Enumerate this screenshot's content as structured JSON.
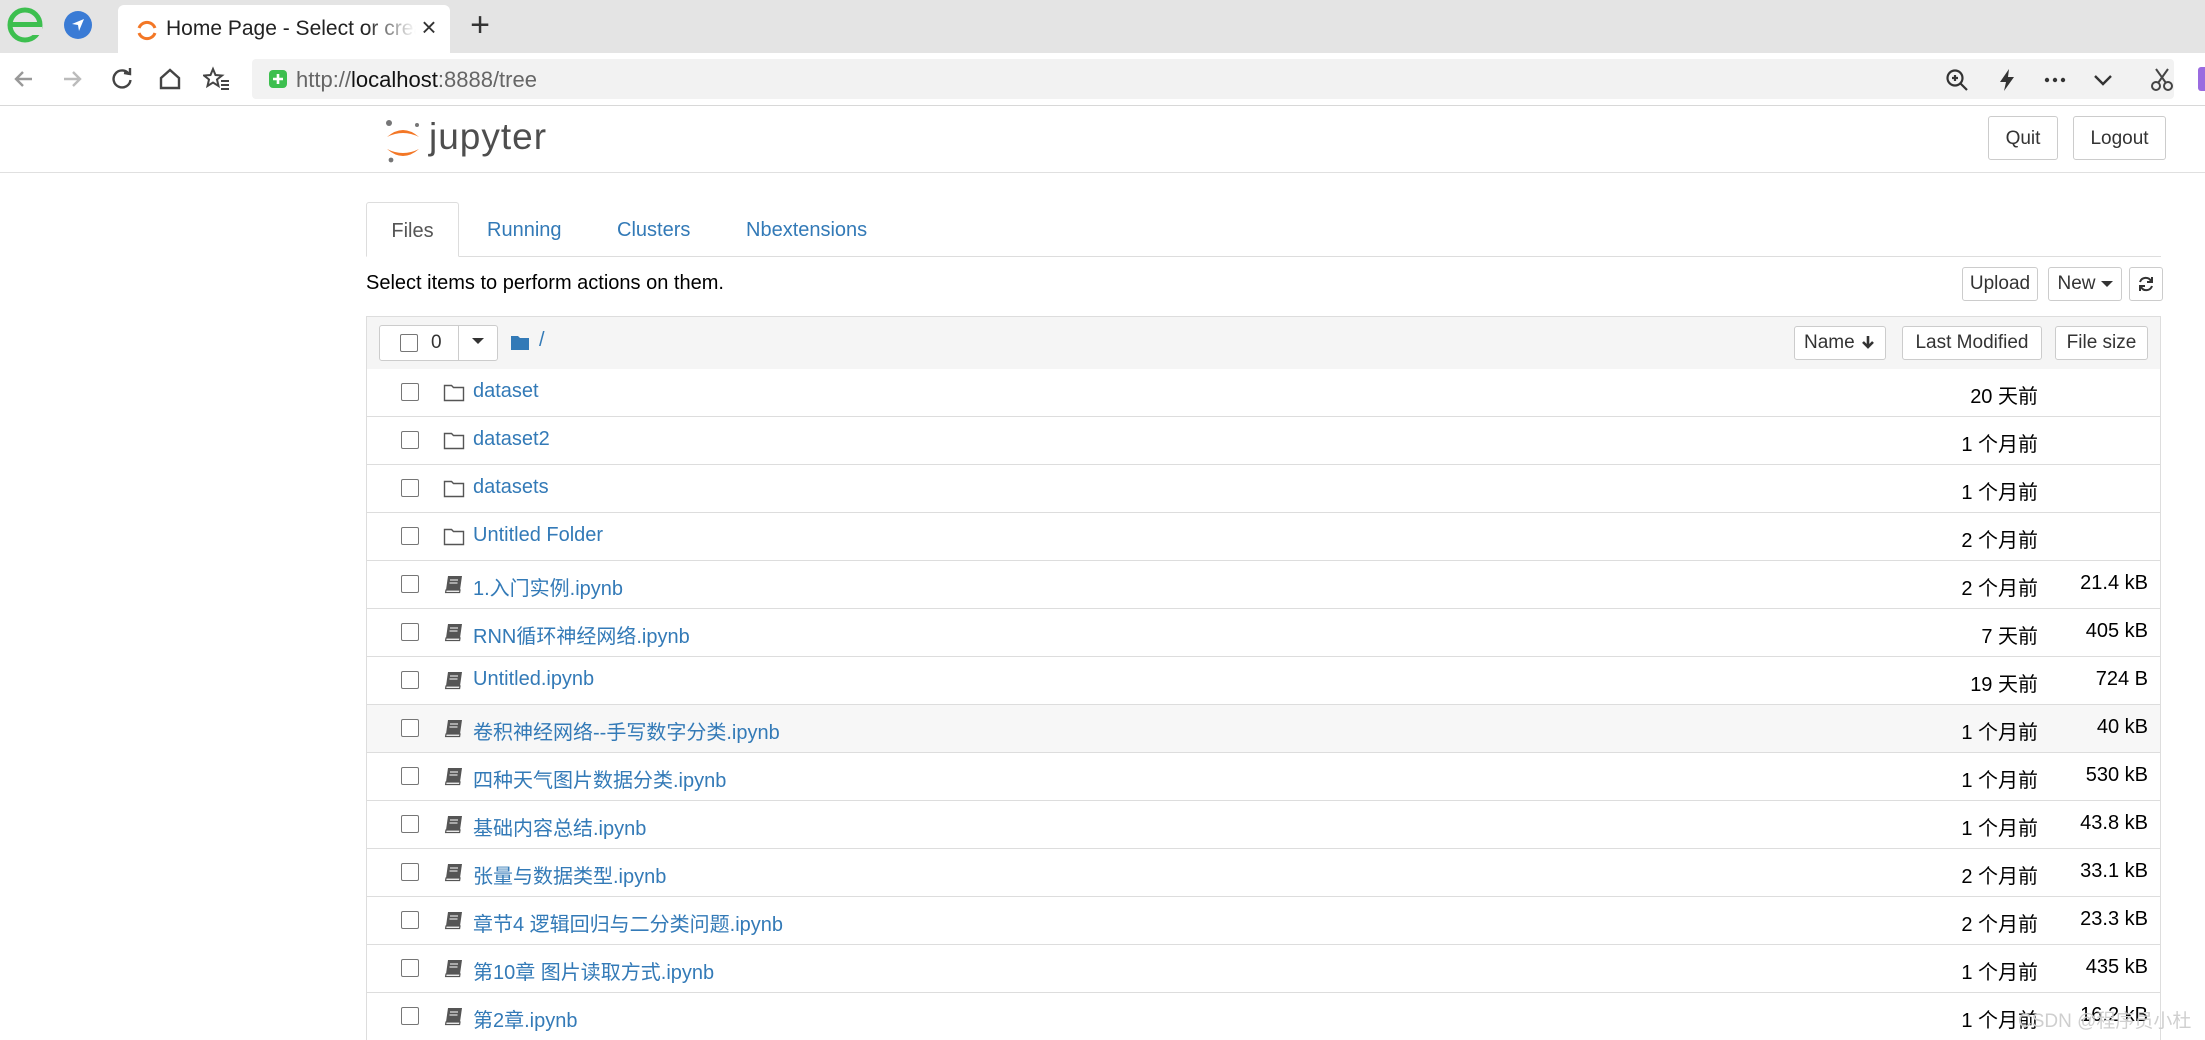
{
  "browser": {
    "tab_title": "Home Page - Select or create a notebook",
    "url_prefix": "http://",
    "url_host": "localhost",
    "url_rest": ":8888/tree"
  },
  "header": {
    "logo_text": "jupyter",
    "quit_label": "Quit",
    "logout_label": "Logout"
  },
  "tabs": [
    {
      "label": "Files"
    },
    {
      "label": "Running"
    },
    {
      "label": "Clusters"
    },
    {
      "label": "Nbextensions"
    }
  ],
  "toolbar": {
    "instructions": "Select items to perform actions on them.",
    "upload_label": "Upload",
    "new_label": "New"
  },
  "list_header": {
    "selected_count": "0",
    "breadcrumb": "/",
    "name_label": "Name",
    "last_modified_label": "Last Modified",
    "file_size_label": "File size"
  },
  "items": [
    {
      "type": "folder",
      "name": "dataset",
      "modified": "20 天前",
      "size": ""
    },
    {
      "type": "folder",
      "name": "dataset2",
      "modified": "1 个月前",
      "size": ""
    },
    {
      "type": "folder",
      "name": "datasets",
      "modified": "1 个月前",
      "size": ""
    },
    {
      "type": "folder",
      "name": "Untitled Folder",
      "modified": "2 个月前",
      "size": ""
    },
    {
      "type": "notebook",
      "name": "1.入门实例.ipynb",
      "modified": "2 个月前",
      "size": "21.4 kB"
    },
    {
      "type": "notebook",
      "name": "RNN循环神经网络.ipynb",
      "modified": "7 天前",
      "size": "405 kB"
    },
    {
      "type": "notebook",
      "name": "Untitled.ipynb",
      "modified": "19 天前",
      "size": "724 B"
    },
    {
      "type": "notebook",
      "name": "卷积神经网络--手写数字分类.ipynb",
      "modified": "1 个月前",
      "size": "40 kB"
    },
    {
      "type": "notebook",
      "name": "四种天气图片数据分类.ipynb",
      "modified": "1 个月前",
      "size": "530 kB"
    },
    {
      "type": "notebook",
      "name": "基础内容总结.ipynb",
      "modified": "1 个月前",
      "size": "43.8 kB"
    },
    {
      "type": "notebook",
      "name": "张量与数据类型.ipynb",
      "modified": "2 个月前",
      "size": "33.1 kB"
    },
    {
      "type": "notebook",
      "name": "章节4 逻辑回归与二分类问题.ipynb",
      "modified": "2 个月前",
      "size": "23.3 kB"
    },
    {
      "type": "notebook",
      "name": "第10章 图片读取方式.ipynb",
      "modified": "1 个月前",
      "size": "435 kB"
    },
    {
      "type": "notebook",
      "name": "第2章.ipynb",
      "modified": "1 个月前",
      "size": "16.2 kB"
    }
  ],
  "watermark": "CSDN @程序员小杜",
  "colors": {
    "link": "#337ab7",
    "jupyter_orange": "#f37726",
    "border": "#dddddd"
  }
}
